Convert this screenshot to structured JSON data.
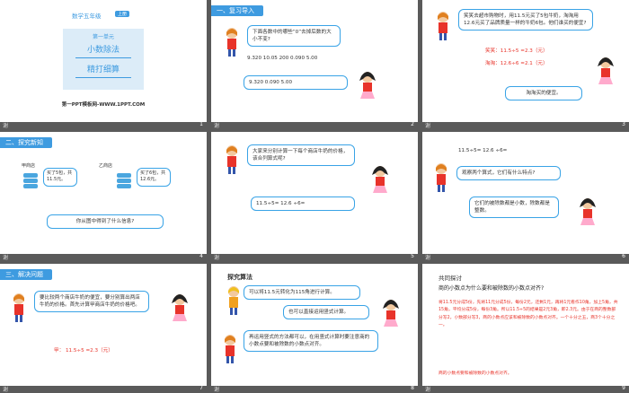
{
  "footer_label": "谢",
  "slides": [
    {
      "number": "1",
      "grade": "数学五年级",
      "badge": "上册",
      "unit": "第一单元",
      "title": "小数除法",
      "subtitle": "精打细算",
      "brand": "第一PPT模板网-WWW.1PPT.COM"
    },
    {
      "number": "2",
      "section": "一、复习导入",
      "question": "下面各数中的哪些“0”去掉后数的大小不变?",
      "numbers": "9.320    10.05    200    0.090    5.00",
      "answer": "9.320     0.090       5.00"
    },
    {
      "number": "3",
      "intro": "笑笑去超市购物时，用11.5元买了5包牛奶，淘淘用12.6元买了品牌质量一样的牛奶6包。他们谁买的便宜?",
      "line1": "笑笑：11.5÷5 =2.3（元）",
      "line2": "淘淘：12.6÷6 =2.1（元）",
      "conclusion": "淘淘买的便宜。"
    },
    {
      "number": "4",
      "section": "二、探究新知",
      "shop1": "甲商店",
      "bubble1": "买了5包，共11.5元。",
      "shop2": "乙商店",
      "bubble2": "买了6包，共12.6元。",
      "question": "你从图中得到了什么信息?"
    },
    {
      "number": "5",
      "prompt": "大家来分别计算一下每个商店牛奶的价格，该合列算式呢?",
      "formula": "11.5÷5=          12.6 ÷6="
    },
    {
      "number": "6",
      "formula": "11.5÷5=          12.6 ÷6=",
      "question": "观察两个算式，它们有什么特点?",
      "answer": "它们的被除数都是小数，除数都是整数。"
    },
    {
      "number": "7",
      "section": "三、解决问题",
      "task": "要比较两个商店牛奶的便宜，要分别算出两店牛奶的价格。首先计算甲商店牛奶的价格吧。",
      "answer": "甲：  11.5÷5 =2.3（元）"
    },
    {
      "number": "8",
      "heading": "探究算法",
      "idea1": "可以将11.5元转化为115角进行计算。",
      "idea2": "也可以直接运用竖式计算。",
      "idea3": "再运用竖式的方法都可以，在用竖式计算时要注意商的小数点要和被除数的小数点对齐。"
    },
    {
      "number": "9",
      "heading": "共同探讨",
      "question": "商的小数点为什么要和被除数的小数点对齐?",
      "paragraph": "将11.5元分成5份，先将11元分成5份，每份2元，还剩1元，再将1元看作10角，加上5角，共15角，平均分成5份，每份3角。所以11.5÷5的结果是2元3角，即2.3元。由于在商的整数部分写2，小数部分写3，商的小数点应该和被除数的小数点对齐。一个十分之五，商3个十分之一。",
      "footnote": "商的小数点要和被除数的小数点对齐。"
    }
  ],
  "colors": {
    "accent": "#3e9be0",
    "bubble_border": "#39a3e6",
    "red": "#e8332a",
    "footer": "#5a5a5a"
  }
}
